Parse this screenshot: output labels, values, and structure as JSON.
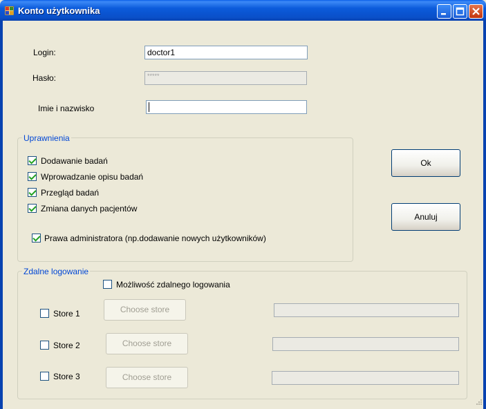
{
  "window": {
    "title": "Konto użytkownika"
  },
  "form": {
    "login_label": "Login:",
    "login_value": "doctor1",
    "password_label": "Hasło:",
    "password_value": "*****",
    "name_label": "Imie i nazwisko",
    "name_value": ""
  },
  "permissions": {
    "title": "Uprawnienia",
    "items": [
      {
        "label": "Dodawanie badań",
        "checked": true
      },
      {
        "label": "Wprowadzanie opisu badań",
        "checked": true
      },
      {
        "label": "Przegląd badań",
        "checked": true
      },
      {
        "label": "Zmiana danych pacjentów",
        "checked": true
      }
    ],
    "admin": {
      "label": "Prawa administratora (np.dodawanie nowych użytkowników)",
      "checked": true
    }
  },
  "remote": {
    "title": "Zdalne logowanie",
    "enable_label": "Możliwość zdalnego logowania",
    "stores": [
      {
        "label": "Store 1",
        "button": "Choose store",
        "path": ""
      },
      {
        "label": "Store 2",
        "button": "Choose store",
        "path": ""
      },
      {
        "label": "Store 3",
        "button": "Choose store",
        "path": ""
      }
    ]
  },
  "buttons": {
    "ok": "Ok",
    "cancel": "Anuluj"
  }
}
